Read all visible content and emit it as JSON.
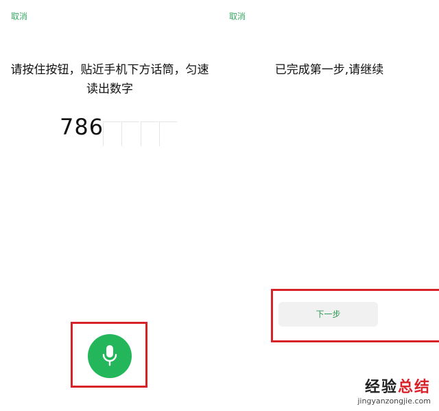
{
  "left_screen": {
    "cancel_label": "取消",
    "instruction": "请按住按钮，贴近手机下方话筒，匀速读出数字",
    "digits": "786",
    "mic_icon": "microphone-icon"
  },
  "right_screen": {
    "cancel_label": "取消",
    "instruction": "已完成第一步,请继续",
    "next_label": "下一步"
  },
  "watermark": {
    "title_part1": "经验",
    "title_part2": "总结",
    "url": "jingyanzongjie.com"
  },
  "colors": {
    "accent_green": "#23b65b",
    "link_green": "#3aa863",
    "highlight_red": "#d8222a"
  }
}
